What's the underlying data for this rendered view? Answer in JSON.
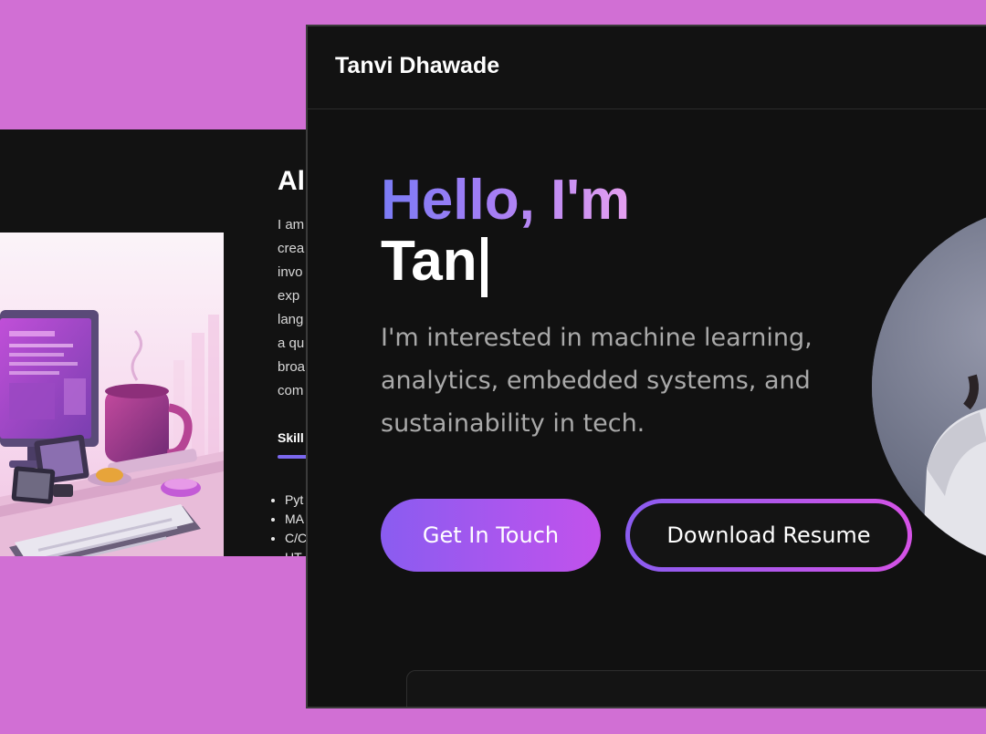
{
  "back_window": {
    "about_title": "Al",
    "about_lines": [
      "I am",
      "crea",
      "invo",
      "exp",
      "lang",
      "a qu",
      "broa",
      "com"
    ],
    "skills_tab": "Skill",
    "skills": [
      "Pyt",
      "MA",
      "C/C",
      "HT"
    ],
    "illustration": "desk-computer-illustration"
  },
  "front_window": {
    "brand": "Tanvi Dhawade",
    "hero": {
      "greeting": "Hello, I'm",
      "typed_name": "Tan",
      "description_lines": [
        "I'm interested in machine learning,",
        "analytics, embedded systems, and",
        "sustainability in tech."
      ]
    },
    "buttons": {
      "get_in_touch": "Get In Touch",
      "download_resume": "Download Resume"
    },
    "profile_photo": "profile-photo"
  },
  "colors": {
    "background": "#d16fd4",
    "window": "#111111",
    "accent_start": "#8a5cf0",
    "accent_end": "#c252ec",
    "greeting_start": "#7b7cf5",
    "greeting_end": "#e6a0f0",
    "muted_text": "#a9a9a9"
  }
}
